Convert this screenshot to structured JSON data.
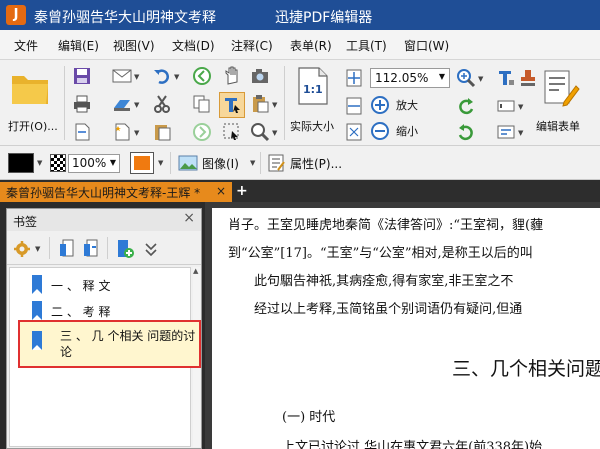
{
  "titlebar": {
    "document_title": "秦曾孙骃告华大山明神文考释",
    "app_name": "迅捷PDF编辑器",
    "logo_glyph": "J"
  },
  "menu": [
    "文件",
    "编辑(E)",
    "视图(V)",
    "文档(D)",
    "注释(C)",
    "表单(R)",
    "工具(T)",
    "窗口(W)"
  ],
  "toolbar": {
    "open_label": "打开(O)...",
    "actual_size_label": "实际大小",
    "zoom_value": "112.05%",
    "zoom_in_label": "放大",
    "zoom_out_label": "缩小",
    "edit_form_label": "编辑表单",
    "actual_size_glyph": "1:1"
  },
  "props": {
    "opacity": "100%",
    "image_label": "图像(I)",
    "properties_label": "属性(P)...",
    "fill_color": "#000000",
    "stroke_color": "#f07a10"
  },
  "tab": {
    "title": "秦曾孙骃告华大山明神文考释-王辉 *",
    "close": "×",
    "add": "+"
  },
  "sidebar": {
    "title": "书签",
    "close": "×",
    "bookmarks": [
      {
        "label": "一 、 释 文"
      },
      {
        "label": "二 、 考 释"
      },
      {
        "label": "三 、 几 个相关 问题的讨论"
      }
    ]
  },
  "document": {
    "lines": [
      "肖子。王室见睡虎地秦简《法律答问》:“王室祠，貍(薶",
      "到“公室”[17]。“王室”与“公室”相对,是称王以后的叫",
      "此句駰告神祇,其病痊愈,得有家室,非王室之不",
      "经过以上考释,玉简铭虽个别词语仍有疑问,但通"
    ],
    "heading": "三、几个相关问题",
    "subheading": "(一) 时代",
    "last_line": "上文已讨论过,华山在惠文君六年(前338年)始"
  },
  "colors": {
    "titlebar": "#1f4e96",
    "tab_active": "#e78a1c",
    "selection_border": "#e03030",
    "bookmark_flag": "#2e7ad6"
  }
}
